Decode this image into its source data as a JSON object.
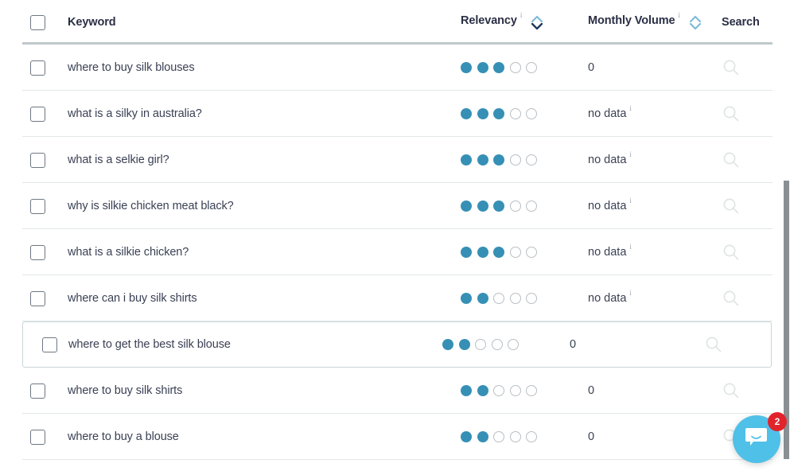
{
  "table": {
    "columns": {
      "checkbox": {
        "name": "select-all",
        "checked": false
      },
      "keyword": {
        "label": "Keyword"
      },
      "relevancy": {
        "label": "Relevancy",
        "info": "i",
        "sort_state": "desc"
      },
      "monthly_volume": {
        "label": "Monthly Volume",
        "info": "i",
        "sort_state": "none"
      },
      "search": {
        "label": "Search"
      }
    },
    "rows": [
      {
        "keyword": "where to buy silk blouses",
        "relevancy": 3,
        "relevancy_max": 5,
        "volume": "0",
        "volume_info": false,
        "selected": false
      },
      {
        "keyword": "what is a silky in australia?",
        "relevancy": 3,
        "relevancy_max": 5,
        "volume": "no data",
        "volume_info": true,
        "selected": false
      },
      {
        "keyword": "what is a selkie girl?",
        "relevancy": 3,
        "relevancy_max": 5,
        "volume": "no data",
        "volume_info": true,
        "selected": false
      },
      {
        "keyword": "why is silkie chicken meat black?",
        "relevancy": 3,
        "relevancy_max": 5,
        "volume": "no data",
        "volume_info": true,
        "selected": false
      },
      {
        "keyword": "what is a silkie chicken?",
        "relevancy": 3,
        "relevancy_max": 5,
        "volume": "no data",
        "volume_info": true,
        "selected": false
      },
      {
        "keyword": "where can i buy silk shirts",
        "relevancy": 2,
        "relevancy_max": 5,
        "volume": "no data",
        "volume_info": true,
        "selected": false
      },
      {
        "keyword": "where to get the best silk blouse",
        "relevancy": 2,
        "relevancy_max": 5,
        "volume": "0",
        "volume_info": false,
        "selected": true
      },
      {
        "keyword": "where to buy silk shirts",
        "relevancy": 2,
        "relevancy_max": 5,
        "volume": "0",
        "volume_info": false,
        "selected": false
      },
      {
        "keyword": "where to buy a blouse",
        "relevancy": 2,
        "relevancy_max": 5,
        "volume": "0",
        "volume_info": false,
        "selected": false
      }
    ]
  },
  "icons": {
    "sort": "sort-chevrons-icon",
    "search": "search-magnifier-icon",
    "info": "info-superscript-icon",
    "chat": "chat-bubble-icon"
  },
  "intercom": {
    "unread_count": "2",
    "bubble_color": "#4fc0e8",
    "badge_color": "#e1242b"
  },
  "colors": {
    "dot_filled": "#3690b5",
    "dot_empty_border": "#b9bfc4",
    "header_text": "#2b2f45",
    "row_text": "#3a4154",
    "header_rule": "#bfc8cb",
    "row_rule": "#e2e7e8",
    "sort_active": "#1f3a5f",
    "sort_inactive": "#7cb9d8",
    "selected_border": "#cbd5d8",
    "magnifier": "#dfe5e3"
  }
}
